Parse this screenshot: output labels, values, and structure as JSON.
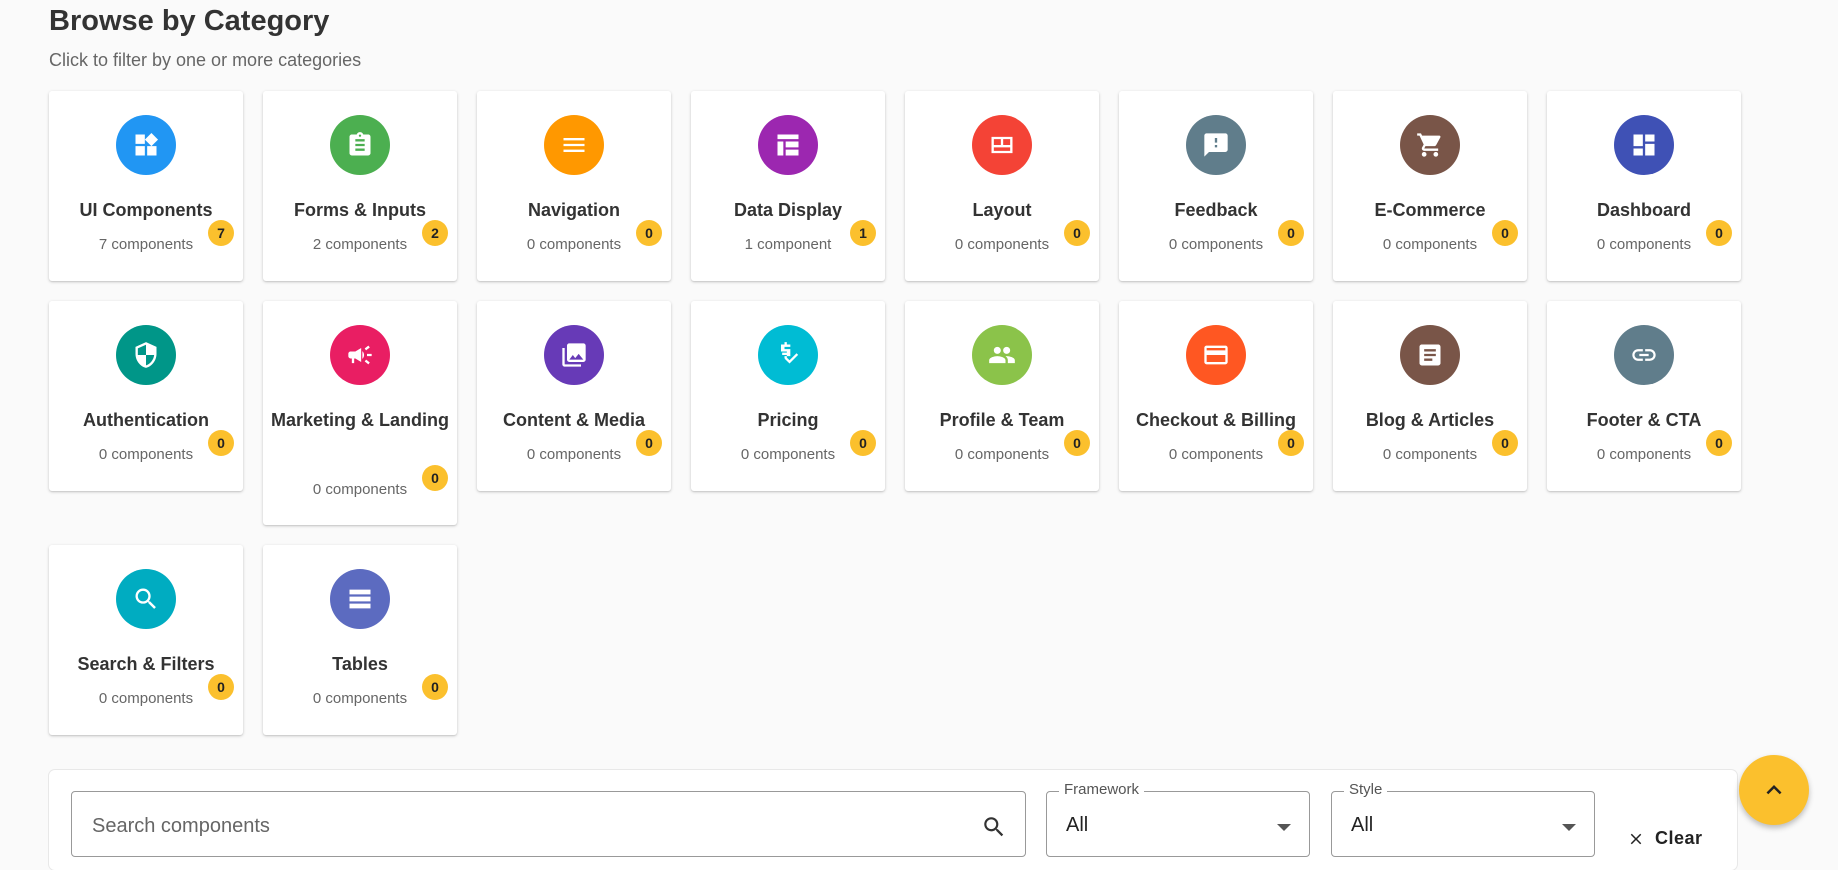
{
  "header": {
    "title": "Browse by Category",
    "subtitle": "Click to filter by one or more categories"
  },
  "categories": [
    {
      "name": "UI Components",
      "count_label": "7 components",
      "badge": "7",
      "icon": "widgets-icon",
      "color": "#2196f3"
    },
    {
      "name": "Forms & Inputs",
      "count_label": "2 components",
      "badge": "2",
      "icon": "clipboard-icon",
      "color": "#4caf50"
    },
    {
      "name": "Navigation",
      "count_label": "0 components",
      "badge": "0",
      "icon": "menu-icon",
      "color": "#ff9800"
    },
    {
      "name": "Data Display",
      "count_label": "1 component",
      "badge": "1",
      "icon": "table-icon",
      "color": "#9c27b0"
    },
    {
      "name": "Layout",
      "count_label": "0 components",
      "badge": "0",
      "icon": "layout-icon",
      "color": "#f44336"
    },
    {
      "name": "Feedback",
      "count_label": "0 components",
      "badge": "0",
      "icon": "feedback-icon",
      "color": "#607d8b"
    },
    {
      "name": "E-Commerce",
      "count_label": "0 components",
      "badge": "0",
      "icon": "cart-icon",
      "color": "#795548"
    },
    {
      "name": "Dashboard",
      "count_label": "0 components",
      "badge": "0",
      "icon": "dashboard-icon",
      "color": "#3f51b5"
    },
    {
      "name": "Authentication",
      "count_label": "0 components",
      "badge": "0",
      "icon": "shield-icon",
      "color": "#009688"
    },
    {
      "name": "Marketing & Landing",
      "count_label": "0 components",
      "badge": "0",
      "icon": "megaphone-icon",
      "color": "#e91e63"
    },
    {
      "name": "Content & Media",
      "count_label": "0 components",
      "badge": "0",
      "icon": "photo-library-icon",
      "color": "#673ab7"
    },
    {
      "name": "Pricing",
      "count_label": "0 components",
      "badge": "0",
      "icon": "price-check-icon",
      "color": "#00bcd4"
    },
    {
      "name": "Profile & Team",
      "count_label": "0 components",
      "badge": "0",
      "icon": "people-icon",
      "color": "#8bc34a"
    },
    {
      "name": "Checkout & Billing",
      "count_label": "0 components",
      "badge": "0",
      "icon": "credit-card-icon",
      "color": "#ff5722"
    },
    {
      "name": "Blog & Articles",
      "count_label": "0 components",
      "badge": "0",
      "icon": "article-icon",
      "color": "#795548"
    },
    {
      "name": "Footer & CTA",
      "count_label": "0 components",
      "badge": "0",
      "icon": "link-icon",
      "color": "#607d8b"
    },
    {
      "name": "Search & Filters",
      "count_label": "0 components",
      "badge": "0",
      "icon": "search-icon",
      "color": "#00acc1"
    },
    {
      "name": "Tables",
      "count_label": "0 components",
      "badge": "0",
      "icon": "view-list-icon",
      "color": "#5c6bc0"
    }
  ],
  "filters": {
    "search_placeholder": "Search components",
    "framework_label": "Framework",
    "framework_value": "All",
    "style_label": "Style",
    "style_value": "All",
    "clear_label": "Clear"
  },
  "accent_color": "#fbc02d"
}
